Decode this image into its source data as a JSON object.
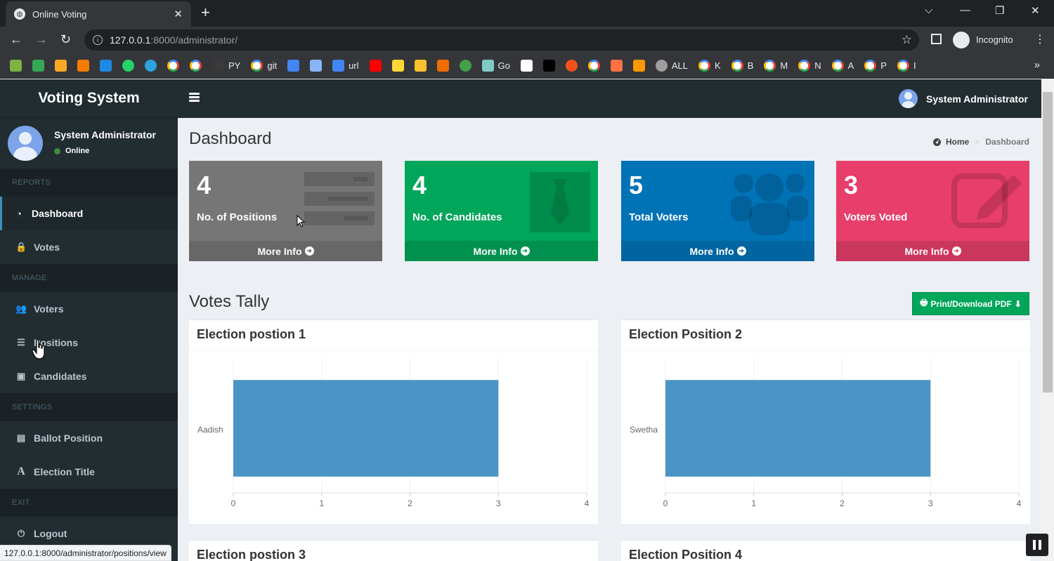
{
  "browser": {
    "tab_title": "Online Voting",
    "tab_close": "✕",
    "new_tab": "+",
    "url_host": "127.0.0.1",
    "url_path": ":8000/administrator/",
    "profile_label": "Incognito",
    "window_controls": [
      "⌵",
      "—",
      "❐",
      "✕"
    ],
    "bookmarks": [
      {
        "icon": "leaf-icon",
        "color": "#7cb342",
        "label": ""
      },
      {
        "icon": "plus-square-icon",
        "color": "#34a853",
        "label": ""
      },
      {
        "icon": "blogger-icon",
        "color": "#f9a825",
        "label": ""
      },
      {
        "icon": "bar-chart-icon",
        "color": "#f57c00",
        "label": ""
      },
      {
        "icon": "ieee-icon",
        "color": "#1e88e5",
        "label": ""
      },
      {
        "icon": "whatsapp-icon",
        "color": "#25d366",
        "label": ""
      },
      {
        "icon": "telegram-icon",
        "color": "#2aa3e0",
        "label": ""
      },
      {
        "icon": "google-icon",
        "color": "#ffffff",
        "label": ""
      },
      {
        "icon": "google-icon",
        "color": "#ffffff",
        "label": ""
      },
      {
        "icon": "github-icon",
        "color": "#3a3a3a",
        "label": "PY"
      },
      {
        "icon": "google-icon",
        "color": "#ffffff",
        "label": "git"
      },
      {
        "icon": "image-icon",
        "color": "#4285f4",
        "label": ""
      },
      {
        "icon": "car-icon",
        "color": "#8ab4f8",
        "label": ""
      },
      {
        "icon": "wifi-icon",
        "color": "#4285f4",
        "label": "url"
      },
      {
        "icon": "youtube-icon",
        "color": "#ff0000",
        "label": ""
      },
      {
        "icon": "p-icon",
        "color": "#fdd835",
        "label": ""
      },
      {
        "icon": "camera-icon",
        "color": "#fbc02d",
        "label": ""
      },
      {
        "icon": "cup-icon",
        "color": "#ef6c00",
        "label": ""
      },
      {
        "icon": "circle-icon",
        "color": "#43a047",
        "label": ""
      },
      {
        "icon": "swirl-icon",
        "color": "#80cbc4",
        "label": "Go"
      },
      {
        "icon": "flag-icon",
        "color": "#ffffff",
        "label": ""
      },
      {
        "icon": "cl-icon",
        "color": "#000000",
        "label": ""
      },
      {
        "icon": "yandex-icon",
        "color": "#f4511e",
        "label": ""
      },
      {
        "icon": "google-icon",
        "color": "#ffffff",
        "label": ""
      },
      {
        "icon": "bolt-icon",
        "color": "#ff7043",
        "label": ""
      },
      {
        "icon": "eye-icon",
        "color": "#ff9800",
        "label": ""
      },
      {
        "icon": "globe-icon",
        "color": "#9e9e9e",
        "label": "ALL"
      },
      {
        "icon": "google-icon",
        "color": "#ffffff",
        "label": "K"
      },
      {
        "icon": "google-icon",
        "color": "#ffffff",
        "label": "B"
      },
      {
        "icon": "google-icon",
        "color": "#ffffff",
        "label": "M"
      },
      {
        "icon": "google-icon",
        "color": "#ffffff",
        "label": "N"
      },
      {
        "icon": "google-icon",
        "color": "#ffffff",
        "label": "A"
      },
      {
        "icon": "google-icon",
        "color": "#ffffff",
        "label": "P"
      },
      {
        "icon": "google-icon",
        "color": "#ffffff",
        "label": "I"
      }
    ],
    "status_url": "127.0.0.1:8000/administrator/positions/view"
  },
  "app": {
    "logo": "Voting System",
    "user_name": "System Administrator",
    "user_status": "Online",
    "top_username": "System Administrator"
  },
  "sidebar": {
    "sections": [
      {
        "header": "REPORTS",
        "items": [
          {
            "label": "Dashboard",
            "icon": "dashboard-icon",
            "active": true
          },
          {
            "label": "Votes",
            "icon": "lock-icon",
            "active": false
          }
        ]
      },
      {
        "header": "MANAGE",
        "items": [
          {
            "label": "Voters",
            "icon": "users-icon",
            "active": false
          },
          {
            "label": "Positions",
            "icon": "tasks-icon",
            "active": false
          },
          {
            "label": "Candidates",
            "icon": "id-card-icon",
            "active": false
          }
        ]
      },
      {
        "header": "SETTINGS",
        "items": [
          {
            "label": "Ballot Position",
            "icon": "file-text-icon",
            "active": false
          },
          {
            "label": "Election Title",
            "icon": "font-icon",
            "active": false
          }
        ]
      },
      {
        "header": "EXIT",
        "items": [
          {
            "label": "Logout",
            "icon": "power-icon",
            "active": false
          }
        ]
      }
    ]
  },
  "dashboard": {
    "title": "Dashboard",
    "breadcrumb_home": "Home",
    "breadcrumb_sep": ">",
    "breadcrumb_current": "Dashboard",
    "cards": [
      {
        "value": "4",
        "label": "No. of Positions",
        "footer": "More Info",
        "color": "#767676",
        "icon": "list-icon"
      },
      {
        "value": "4",
        "label": "No. of Candidates",
        "footer": "More Info",
        "color": "#00a65a",
        "icon": "tie-icon"
      },
      {
        "value": "5",
        "label": "Total Voters",
        "footer": "More Info",
        "color": "#0073b7",
        "icon": "users-icon"
      },
      {
        "value": "3",
        "label": "Voters Voted",
        "footer": "More Info",
        "color": "#e83e6c",
        "icon": "edit-icon"
      }
    ],
    "tally_title": "Votes Tally",
    "print_label": "Print/Download PDF"
  },
  "chart_data": [
    {
      "type": "bar",
      "orientation": "horizontal",
      "title": "Election postion 1",
      "categories": [
        "Aadish"
      ],
      "values": [
        3
      ],
      "xlim": [
        0,
        4
      ],
      "xticks": [
        0,
        1,
        2,
        3,
        4
      ],
      "color": "#4b94c6",
      "grid": true
    },
    {
      "type": "bar",
      "orientation": "horizontal",
      "title": "Election Position 2",
      "categories": [
        "Swetha"
      ],
      "values": [
        3
      ],
      "xlim": [
        0,
        4
      ],
      "xticks": [
        0,
        1,
        2,
        3,
        4
      ],
      "color": "#4b94c6",
      "grid": true
    },
    {
      "type": "bar",
      "title": "Election postion 3"
    },
    {
      "type": "bar",
      "title": "Election Position 4"
    }
  ]
}
